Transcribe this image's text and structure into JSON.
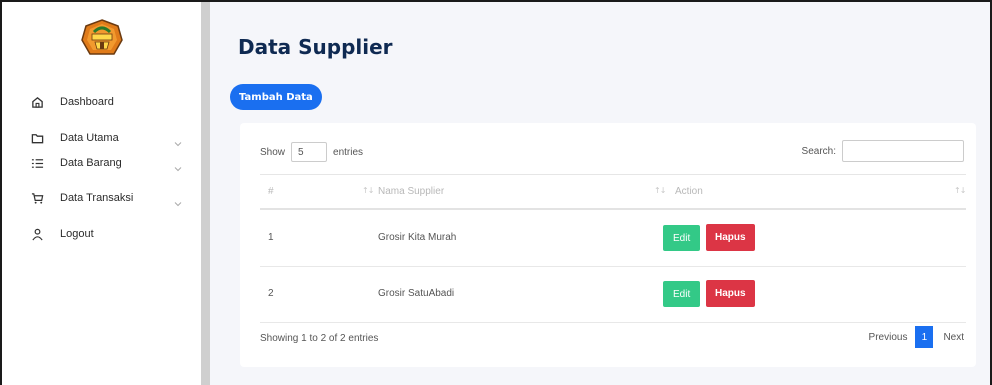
{
  "sidebar": {
    "logo_icon": "crest-logo-icon",
    "items": [
      {
        "label": "Dashboard",
        "icon": "home-icon",
        "has_chevron": false
      },
      {
        "label": "Data Utama",
        "icon": "folder-icon",
        "has_chevron": true
      },
      {
        "label": "Data Barang",
        "icon": "list-icon",
        "has_chevron": true
      },
      {
        "label": "Data Transaksi",
        "icon": "cart-icon",
        "has_chevron": true
      },
      {
        "label": "Logout",
        "icon": "user-icon",
        "has_chevron": false
      }
    ]
  },
  "page": {
    "title": "Data Supplier",
    "add_button": "Tambah Data"
  },
  "table": {
    "show_label": "Show",
    "entries_value": "5",
    "entries_label": "entries",
    "search_label": "Search:",
    "search_value": "",
    "columns": [
      "#",
      "Nama Supplier",
      "Action"
    ],
    "rows": [
      {
        "no": "1",
        "name": "Grosir Kita Murah",
        "edit": "Edit",
        "delete": "Hapus"
      },
      {
        "no": "2",
        "name": "Grosir SatuAbadi",
        "edit": "Edit",
        "delete": "Hapus"
      }
    ],
    "info": "Showing 1 to 2 of 2 entries",
    "pagination": {
      "previous": "Previous",
      "current": "1",
      "next": "Next"
    }
  },
  "colors": {
    "primary": "#1a6ff0",
    "success": "#33c987",
    "danger": "#dc3545",
    "title": "#0f2a52",
    "background": "#f5f6fa"
  }
}
